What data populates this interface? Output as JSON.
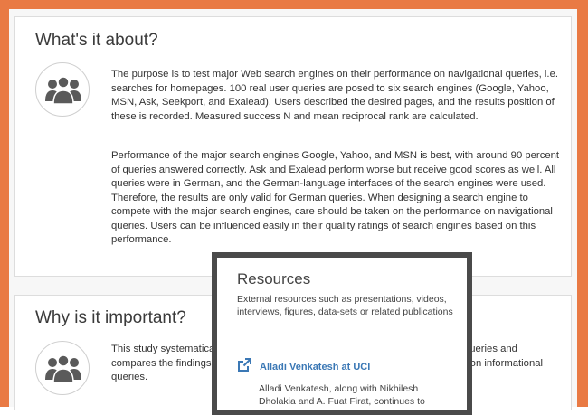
{
  "what": {
    "title": "What's it about?",
    "paragraph1": "The purpose is to test major Web search engines on their performance on navigational queries, i.e. searches for homepages. 100 real user queries are posed to six search engines (Google, Yahoo, MSN, Ask, Seekport, and Exalead). Users described the desired pages, and the results position of these is recorded. Measured success N and mean reciprocal rank are calculated.",
    "paragraph2": "Performance of the major search engines Google, Yahoo, and MSN is best, with around 90 percent of queries answered correctly. Ask and Exalead perform worse but receive good scores as well. All queries were in German, and the German-language interfaces of the search engines were used. Therefore, the results are only valid for German queries. When designing a search engine to compete with the major search engines, care should be taken on the performance on navigational queries. Users can be influenced easily in their quality ratings of search engines based on this performance."
  },
  "why": {
    "title": "Why is it important?",
    "paragraph": "This study systematically compares the major search engines on navigational queries and compares the findings with studies on the retrieval effectiveness of the engines on informational queries."
  },
  "resources": {
    "title": "Resources",
    "description": "External resources such as presentations, videos, interviews, figures, data-sets or related publications",
    "link_label": "Alladi Venkatesh at UCI",
    "note": "Alladi Venkatesh, along with Nikhilesh Dholakia and A. Fuat Firat, continues to"
  },
  "icons": {
    "people": "people-group-icon",
    "external_link": "external-link-icon"
  },
  "colors": {
    "frame": "#e97a44",
    "link": "#3b78b5",
    "popup_border": "#4a4a4a"
  }
}
